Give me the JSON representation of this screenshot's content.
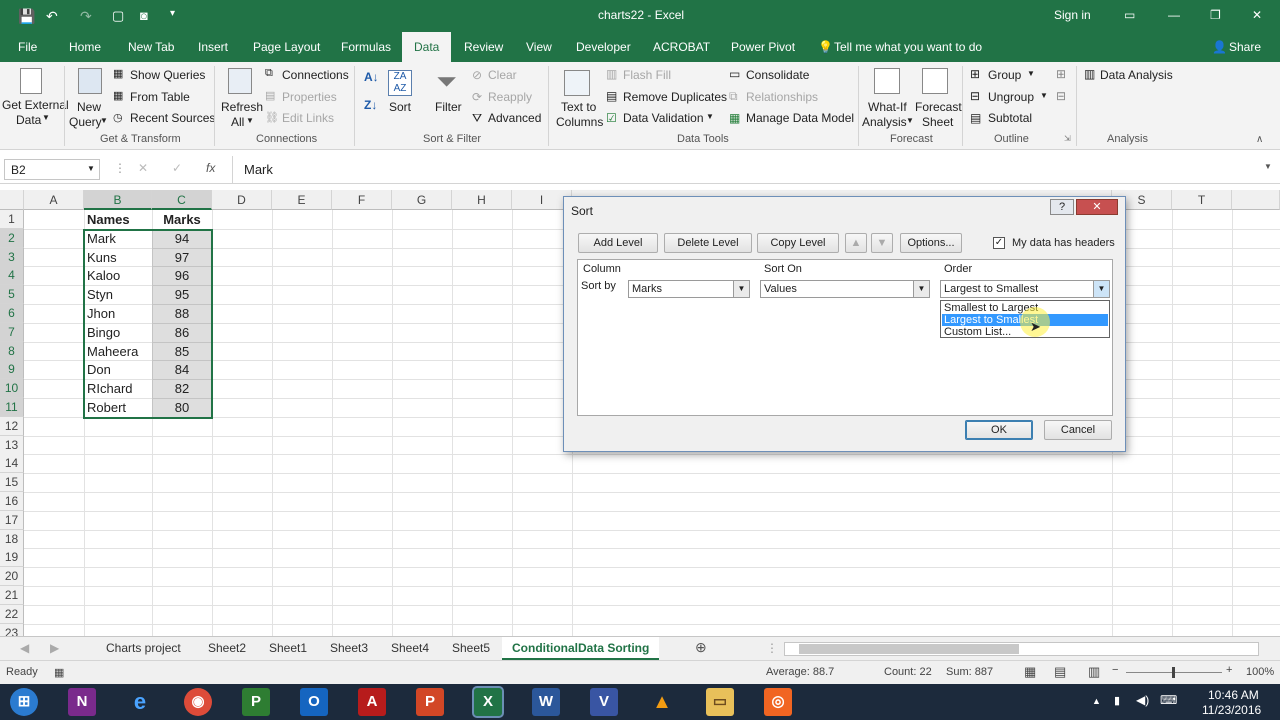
{
  "titlebar": {
    "doc_title": "charts22 - Excel",
    "signin": "Sign in"
  },
  "tabs": [
    "File",
    "Home",
    "New Tab",
    "Insert",
    "Page Layout",
    "Formulas",
    "Data",
    "Review",
    "View",
    "Developer",
    "ACROBAT",
    "Power Pivot"
  ],
  "active_tab": "Data",
  "tell_me": "Tell me what you want to do",
  "share": "Share",
  "ribbon": {
    "get_external": "Get External",
    "get_external2": "Data",
    "new_query": "New",
    "new_query2": "Query",
    "show_queries": "Show Queries",
    "from_table": "From Table",
    "recent_sources": "Recent Sources",
    "refresh": "Refresh",
    "refresh2": "All",
    "connections": "Connections",
    "properties": "Properties",
    "edit_links": "Edit Links",
    "sort": "Sort",
    "filter": "Filter",
    "clear": "Clear",
    "reapply": "Reapply",
    "advanced": "Advanced",
    "text_to": "Text to",
    "columns": "Columns",
    "flash_fill": "Flash Fill",
    "remove_duplicates": "Remove Duplicates",
    "data_validation": "Data Validation",
    "consolidate": "Consolidate",
    "relationships": "Relationships",
    "manage_data_model": "Manage Data Model",
    "whatif": "What-If",
    "whatif2": "Analysis",
    "forecast": "Forecast",
    "forecast2": "Sheet",
    "group": "Group",
    "ungroup": "Ungroup",
    "subtotal": "Subtotal",
    "data_analysis": "Data Analysis",
    "groups": {
      "get_transform": "Get & Transform",
      "connections": "Connections",
      "sort_filter": "Sort & Filter",
      "data_tools": "Data Tools",
      "forecast": "Forecast",
      "outline": "Outline",
      "analysis": "Analysis"
    }
  },
  "formula_bar": {
    "name_box": "B2",
    "fx": "fx",
    "value": "Mark"
  },
  "columns": [
    "A",
    "B",
    "C",
    "D",
    "E",
    "F",
    "G",
    "H",
    "I",
    "S",
    "T"
  ],
  "rows": [
    "1",
    "2",
    "3",
    "4",
    "5",
    "6",
    "7",
    "8",
    "9",
    "10",
    "11",
    "12",
    "13",
    "14",
    "15",
    "16",
    "17",
    "18",
    "19",
    "20",
    "21",
    "22",
    "23"
  ],
  "table": {
    "header_names": "Names",
    "header_marks": "Marks",
    "rows": [
      {
        "name": "Mark",
        "marks": "94"
      },
      {
        "name": "Kuns",
        "marks": "97"
      },
      {
        "name": "Kaloo",
        "marks": "96"
      },
      {
        "name": "Styn",
        "marks": "95"
      },
      {
        "name": "Jhon",
        "marks": "88"
      },
      {
        "name": "Bingo",
        "marks": "86"
      },
      {
        "name": "Maheera",
        "marks": "85"
      },
      {
        "name": "Don",
        "marks": "84"
      },
      {
        "name": "RIchard",
        "marks": "82"
      },
      {
        "name": "Robert",
        "marks": "80"
      }
    ]
  },
  "sheets": [
    "Charts project",
    "Sheet2",
    "Sheet1",
    "Sheet3",
    "Sheet4",
    "Sheet5",
    "ConditionalData Sorting"
  ],
  "status": {
    "ready": "Ready",
    "average": "Average: 88.7",
    "count": "Count: 22",
    "sum": "Sum: 887",
    "zoom": "100%"
  },
  "dialog": {
    "title": "Sort",
    "help": "?",
    "close": "✕",
    "add_level": "Add Level",
    "delete_level": "Delete Level",
    "copy_level": "Copy Level",
    "options": "Options...",
    "headers_label": "My data has headers",
    "col_header": "Column",
    "sorton_header": "Sort On",
    "order_header": "Order",
    "sort_by": "Sort by",
    "column_value": "Marks",
    "sorton_value": "Values",
    "order_value": "Largest to Smallest",
    "order_options": [
      "Smallest to Largest",
      "Largest to Smallest",
      "Custom List..."
    ],
    "ok": "OK",
    "cancel": "Cancel"
  },
  "clock": {
    "time": "10:46 AM",
    "date": "11/23/2016"
  },
  "colors": {
    "excel_green": "#217346",
    "taskbar": "#1c2a3c",
    "highlight": "#3399ff"
  }
}
